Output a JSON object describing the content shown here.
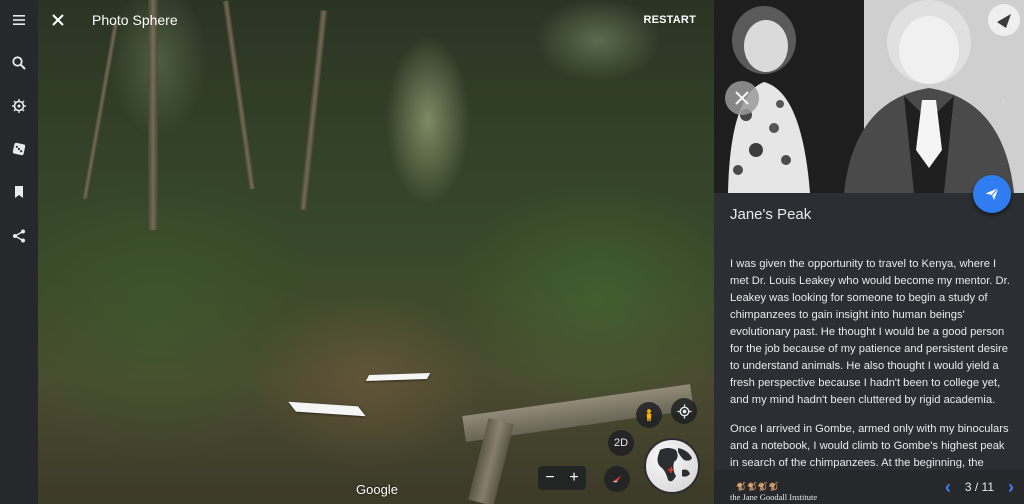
{
  "viewer": {
    "title": "Photo Sphere",
    "restart_label": "RESTART",
    "watermark": "Google",
    "view_mode_label": "2D",
    "zoom_out_label": "−",
    "zoom_in_label": "+"
  },
  "rail": {
    "items": [
      {
        "icon": "menu-icon"
      },
      {
        "icon": "search-icon"
      },
      {
        "icon": "voyager-icon"
      },
      {
        "icon": "dice-icon"
      },
      {
        "icon": "bookmark-icon"
      },
      {
        "icon": "share-icon"
      }
    ]
  },
  "panel": {
    "title": "Jane's Peak",
    "paragraphs": [
      "I was given the opportunity to travel to Kenya, where I met Dr. Louis Leakey who would become my mentor. Dr. Leakey was looking for someone to begin a study of chimpanzees to gain insight into human beings' evolutionary past. He thought I would be a good person for the job because of my patience and persistent desire to understand animals. He also thought I would yield a fresh perspective because I hadn't been to college yet, and my mind hadn't been cluttered by rigid academia.",
      "Once I arrived in Gombe, armed only with my binoculars and a notebook, I would climb to Gombe's highest peak in search of the chimpanzees. At the beginning, the"
    ],
    "footer": {
      "logo_text": "the Jane Goodall Institute",
      "page_indicator": "3 / 11"
    }
  },
  "colors": {
    "accent": "#2f7df0",
    "pager_chevron": "#3b82f6",
    "panel_bg": "#2b2e32",
    "rail_bg": "#26282c"
  }
}
